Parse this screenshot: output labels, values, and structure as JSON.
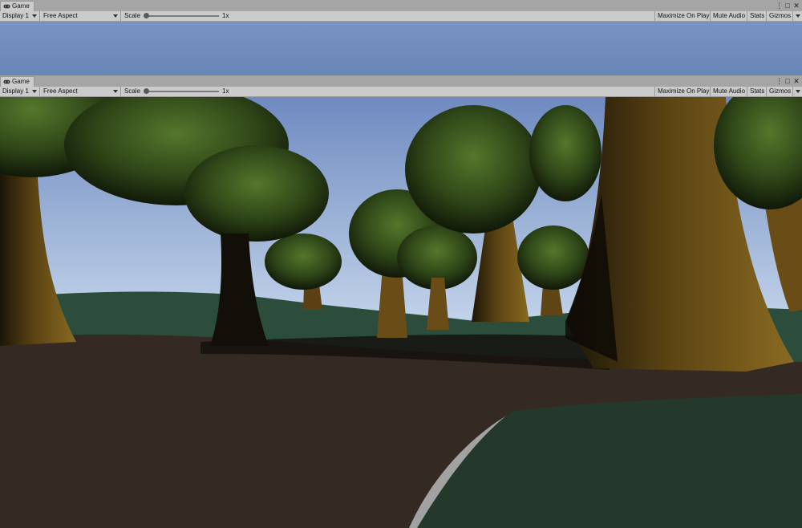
{
  "panels": [
    {
      "tab": {
        "label": "Game",
        "icon": "gamepad-icon"
      },
      "toolbar": {
        "display": "Display 1",
        "aspect": "Free Aspect",
        "scale_label": "Scale",
        "scale_value": "1x",
        "buttons": [
          "Maximize On Play",
          "Mute Audio",
          "Stats",
          "Gizmos"
        ]
      }
    },
    {
      "tab": {
        "label": "Game",
        "icon": "gamepad-icon"
      },
      "toolbar": {
        "display": "Display 1",
        "aspect": "Free Aspect",
        "scale_label": "Scale",
        "scale_value": "1x",
        "buttons": [
          "Maximize On Play",
          "Mute Audio",
          "Stats",
          "Gizmos"
        ]
      }
    }
  ],
  "window_controls_icons": [
    "more-vertical-icon",
    "maximize-icon",
    "close-icon"
  ],
  "colors": {
    "sky_top": "#6e8ac0",
    "sky_bottom": "#c8d8ec",
    "ground": "#3b2e26",
    "grass": "#2c4d3c",
    "trunk": "#7a5a1c",
    "foliage": "#3b5a1f"
  }
}
